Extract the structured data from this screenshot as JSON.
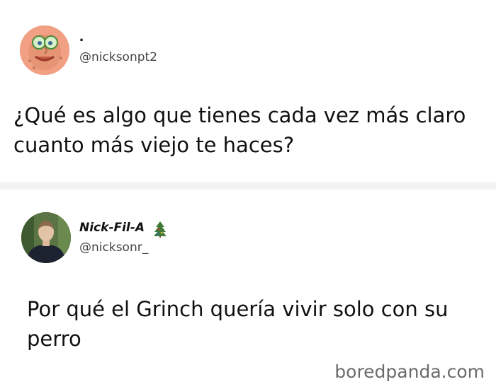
{
  "tweets": [
    {
      "display_name": ".",
      "handle": "@nicksonpt2",
      "avatar": "spongebob-avatar",
      "text": "¿Qué es algo que tienes cada vez más claro cuanto más viejo te haces?"
    },
    {
      "display_name": "Nick-Fil-A",
      "name_emoji": "christmas-tree-icon",
      "handle": "@nicksonr_",
      "avatar": "person-photo-avatar",
      "text": "Por qué el Grinch quería vivir solo con su perro"
    }
  ],
  "watermark": "boredpanda.com"
}
